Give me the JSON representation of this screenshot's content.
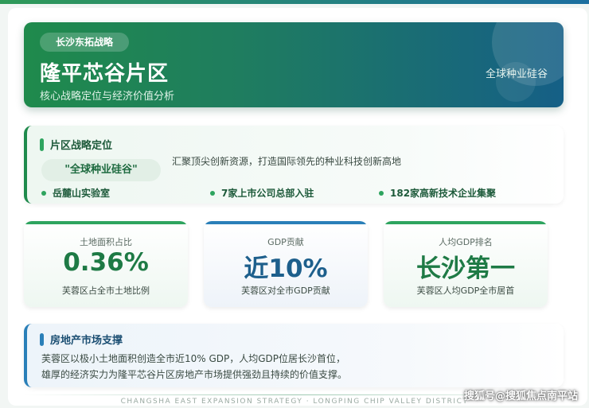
{
  "hero": {
    "tag": "长沙东拓战略",
    "title": "隆平芯谷片区",
    "subtitle": "核心战略定位与经济价值分析",
    "right_label": "全球种业硅谷"
  },
  "positioning": {
    "heading": "片区战略定位",
    "slogan": "\"全球种业硅谷\"",
    "description": "汇聚顶尖创新资源，打造国际领先的种业科技创新高地",
    "features": [
      "岳麓山实验室",
      "7家上市公司总部入驻",
      "182家高新技术企业集聚"
    ]
  },
  "stats": [
    {
      "label": "土地面积占比",
      "value": "0.36%",
      "note": "芙蓉区占全市土地比例",
      "color": "#1e7a45"
    },
    {
      "label": "GDP贡献",
      "value": "近10%",
      "note": "芙蓉区对全市GDP贡献",
      "color": "#1d5f8c"
    },
    {
      "label": "人均GDP排名",
      "value": "长沙第一",
      "note": "芙蓉区人均GDP全市居首",
      "color": "#1e7a45"
    }
  ],
  "market": {
    "heading": "房地产市场支撑",
    "line1": "芙蓉区以极小土地面积创造全市近10% GDP，人均GDP位居长沙首位，",
    "line2": "雄厚的经济实力为隆平芯谷片区房地产市场提供强劲且持续的价值支撑。"
  },
  "footer": "CHANGSHA EAST EXPANSION STRATEGY · LONGPING CHIP VALLEY DISTRICT",
  "watermark": "搜狐号@搜狐焦点南平站",
  "colors": {
    "green": "#2ea45f",
    "blue": "#2a7fb8",
    "stat_bar_1": "#2ea45f",
    "stat_bar_2": "#2a7fb8",
    "stat_bar_3": "#2ea45f"
  }
}
